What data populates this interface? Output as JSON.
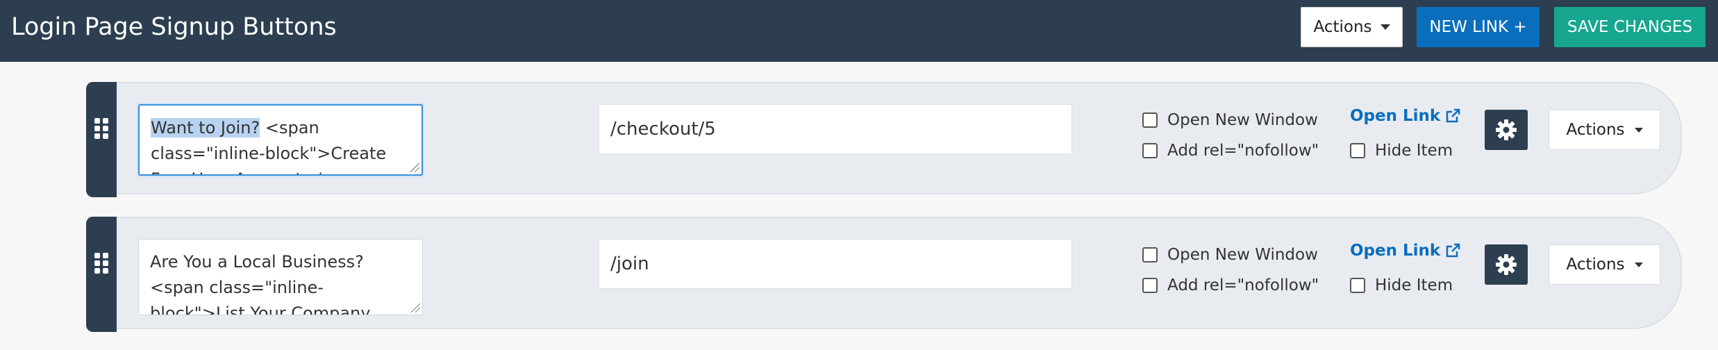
{
  "header": {
    "title": "Login Page Signup Buttons",
    "actions_label": "Actions",
    "new_link_label": "NEW LINK +",
    "save_label": "SAVE CHANGES"
  },
  "rows": [
    {
      "label_selected": "Want to Join?",
      "label_rest": " <span class=\"inline-block\">Create Free User Account</span>",
      "url": "/checkout/5",
      "open_new_window": "Open New Window",
      "nofollow": "Add rel=\"nofollow\"",
      "open_link": "Open Link",
      "hide_item": "Hide Item",
      "actions_label": "Actions"
    },
    {
      "label": "Are You a Local Business? <span class=\"inline-block\">List Your Company Now</span>",
      "url": "/join",
      "open_new_window": "Open New Window",
      "nofollow": "Add rel=\"nofollow\"",
      "open_link": "Open Link",
      "hide_item": "Hide Item",
      "actions_label": "Actions"
    }
  ],
  "colors": {
    "header_bg": "#2c3e50",
    "primary": "#0a6ebd",
    "success": "#17a68f",
    "row_bg": "#e8ecf1"
  }
}
